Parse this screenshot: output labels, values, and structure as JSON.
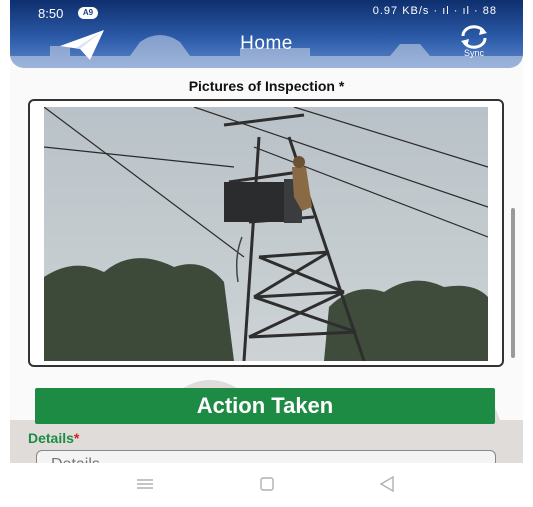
{
  "status_bar": {
    "time": "8:50",
    "badge": "A9",
    "indicators": "0.97 KB/s · ıl · ıl · 88"
  },
  "header": {
    "title": "Home",
    "sync_label": "Sync",
    "back_icon": "send-icon",
    "sync_icon": "sync-icon"
  },
  "inspection": {
    "title": "Pictures of Inspection *"
  },
  "action": {
    "label": "Action Taken"
  },
  "details": {
    "label": "Details",
    "required_mark": "*",
    "placeholder": "Details"
  },
  "nav": {
    "recents": "recents-icon",
    "home": "home-icon",
    "back": "back-icon"
  },
  "colors": {
    "header": "#2b5aa8",
    "action": "#1e8b45",
    "required": "#d0202a"
  }
}
